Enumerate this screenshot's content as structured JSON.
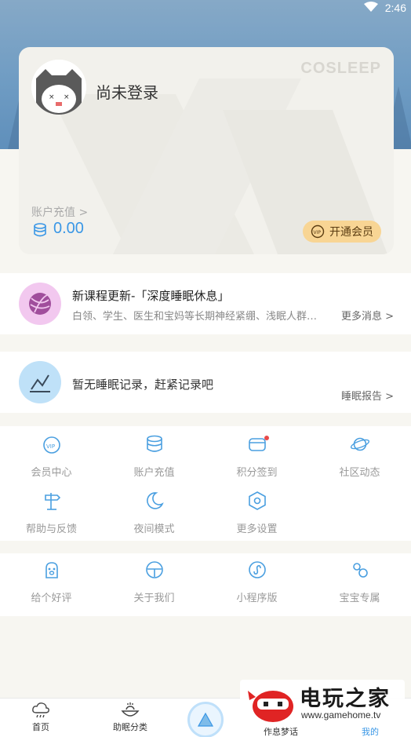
{
  "status_bar": {
    "time": "2:46"
  },
  "profile_card": {
    "login_text": "尚未登录",
    "brand": "COSLEEP",
    "recharge_label": "账户充值 >",
    "balance": "0.00",
    "vip_button_label": "开通会员"
  },
  "news": {
    "title": "新课程更新-「深度睡眠休息」",
    "subtitle": "白领、学生、医生和宝妈等长期神经紧绷、浅眠人群…",
    "more_label": "更多消息 >"
  },
  "sleep_record": {
    "message": "暂无睡眠记录，赶紧记录吧",
    "report_label": "睡眠报告 >"
  },
  "menu_group_1": [
    {
      "label": "会员中心",
      "icon": "vip-icon"
    },
    {
      "label": "账户充值",
      "icon": "coin-stack-icon"
    },
    {
      "label": "积分签到",
      "icon": "points-icon",
      "badge_dot": true
    },
    {
      "label": "社区动态",
      "icon": "planet-icon"
    },
    {
      "label": "帮助与反馈",
      "icon": "signpost-icon"
    },
    {
      "label": "夜间模式",
      "icon": "moon-icon"
    },
    {
      "label": "更多设置",
      "icon": "hexagon-settings-icon"
    }
  ],
  "menu_group_2": [
    {
      "label": "给个好评",
      "icon": "paw-icon"
    },
    {
      "label": "关于我们",
      "icon": "lamp-icon"
    },
    {
      "label": "小程序版",
      "icon": "mini-program-icon"
    },
    {
      "label": "宝宝专属",
      "icon": "pacifier-icon"
    }
  ],
  "tab_bar": {
    "tabs": [
      {
        "label": "首页",
        "icon": "cloud-rain-icon"
      },
      {
        "label": "助眠分类",
        "icon": "bowl-icon"
      },
      {
        "label": "作息梦话",
        "icon": ""
      },
      {
        "label": "我的",
        "icon": "",
        "active": true
      }
    ]
  },
  "watermark": {
    "title": "电玩之家",
    "url": "www.gamehome.tv"
  },
  "colors": {
    "accent": "#3a97e6",
    "vip_gold": "#f8d594",
    "icon_blue": "#4a9fe0"
  }
}
